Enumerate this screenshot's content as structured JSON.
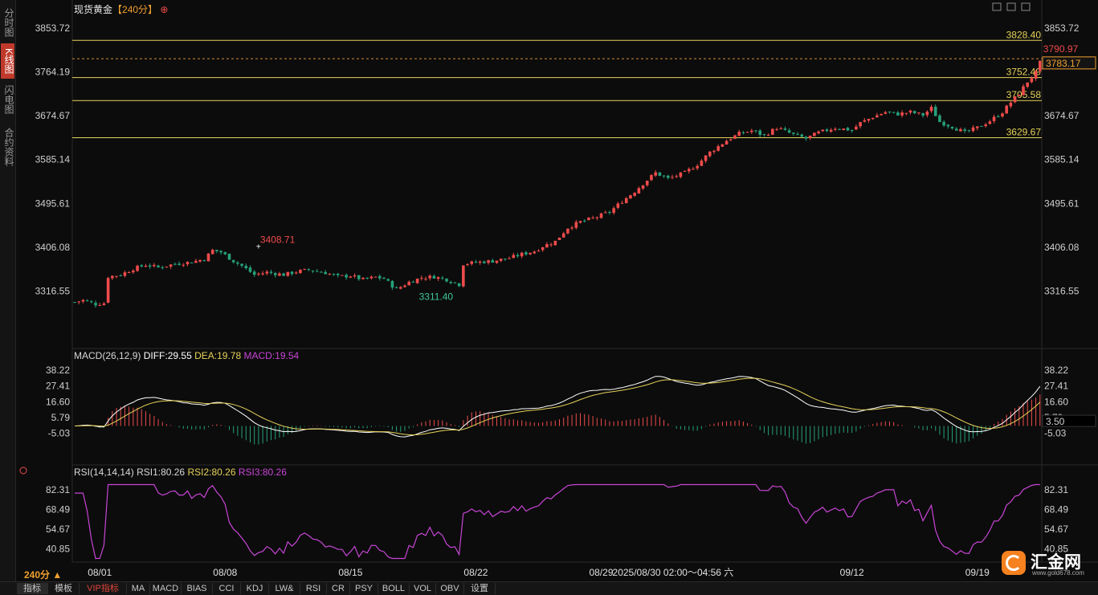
{
  "sidebar": {
    "tabs": [
      "分时图",
      "K线图",
      "闪电图",
      "合约资料"
    ],
    "active": 1
  },
  "header": {
    "title": "现货黄金",
    "period": "【240分】",
    "add_icon": "circle-plus-icon"
  },
  "macd_header": {
    "label": "MACD(26,12,9)",
    "diff": "DIFF:29.55",
    "dea": "DEA:19.78",
    "macd": "MACD:19.54"
  },
  "rsi_header": {
    "label": "RSI(14,14,14)",
    "rsi1": "RSI1:80.26",
    "rsi2": "RSI2:80.26",
    "rsi3": "RSI3:80.26"
  },
  "colors": {
    "up": "#ef4b4b",
    "down": "#26a07a",
    "line_yellow": "#e6d25a",
    "rsi": "#c845d6",
    "diff": "#ffffff",
    "dea": "#e6d25a",
    "label_red": "#ef4b4b",
    "label_green": "#3ec49a"
  },
  "chart_data": [
    {
      "type": "candlestick",
      "title": "现货黄金",
      "period": "240分",
      "y_ticks": [
        "3853.72",
        "3764.19",
        "3674.67",
        "3585.14",
        "3495.61",
        "3406.08",
        "3316.55"
      ],
      "right_ticks": [
        "3853.72",
        "3674.67",
        "3585.14",
        "3495.61",
        "3406.08",
        "3316.55"
      ],
      "ylim": [
        3283,
        3878
      ],
      "x_labels": [
        "08/01",
        "08/08",
        "08/15",
        "08/22",
        "08/29",
        "09/12",
        "09/19"
      ],
      "cursor_time_label": "2025/08/30 02:00～04:56 六",
      "current_price": "3783.17",
      "high_label": "3408.71",
      "low_label": "3311.40",
      "peak_label": "3790.97",
      "horizontal_levels": [
        {
          "value": 3828.4,
          "label": "3828.40"
        },
        {
          "value": 3752.49,
          "label": "3752.49"
        },
        {
          "value": 3705.58,
          "label": "3705.58"
        },
        {
          "value": 3629.67,
          "label": "3629.67"
        }
      ],
      "dashed_level": 3790.97,
      "close_path": [
        [
          0,
          3294
        ],
        [
          2,
          3298
        ],
        [
          5,
          3290
        ],
        [
          7,
          3292
        ],
        [
          8,
          3346
        ],
        [
          11,
          3350
        ],
        [
          14,
          3362
        ],
        [
          17,
          3370
        ],
        [
          20,
          3365
        ],
        [
          24,
          3372
        ],
        [
          28,
          3376
        ],
        [
          31,
          3382
        ],
        [
          33,
          3400
        ],
        [
          35,
          3396
        ],
        [
          38,
          3378
        ],
        [
          40,
          3368
        ],
        [
          43,
          3350
        ],
        [
          46,
          3355
        ],
        [
          50,
          3350
        ],
        [
          53,
          3356
        ],
        [
          56,
          3360
        ],
        [
          60,
          3354
        ],
        [
          63,
          3346
        ],
        [
          66,
          3348
        ],
        [
          69,
          3340
        ],
        [
          72,
          3345
        ],
        [
          74,
          3342
        ],
        [
          77,
          3320
        ],
        [
          80,
          3335
        ],
        [
          83,
          3344
        ],
        [
          86,
          3346
        ],
        [
          89,
          3340
        ],
        [
          92,
          3330
        ],
        [
          93,
          3372
        ],
        [
          97,
          3376
        ],
        [
          100,
          3378
        ],
        [
          104,
          3384
        ],
        [
          107,
          3392
        ],
        [
          110,
          3398
        ],
        [
          112,
          3408
        ],
        [
          115,
          3418
        ],
        [
          118,
          3446
        ],
        [
          121,
          3458
        ],
        [
          124,
          3465
        ],
        [
          128,
          3478
        ],
        [
          131,
          3500
        ],
        [
          134,
          3520
        ],
        [
          136,
          3536
        ],
        [
          139,
          3558
        ],
        [
          142,
          3546
        ],
        [
          146,
          3558
        ],
        [
          149,
          3575
        ],
        [
          152,
          3600
        ],
        [
          156,
          3624
        ],
        [
          159,
          3638
        ],
        [
          162,
          3644
        ],
        [
          165,
          3634
        ],
        [
          168,
          3650
        ],
        [
          172,
          3636
        ],
        [
          175,
          3628
        ],
        [
          178,
          3640
        ],
        [
          182,
          3650
        ],
        [
          186,
          3645
        ],
        [
          188,
          3660
        ],
        [
          191,
          3672
        ],
        [
          194,
          3682
        ],
        [
          197,
          3678
        ],
        [
          200,
          3682
        ],
        [
          203,
          3676
        ],
        [
          205,
          3690
        ],
        [
          207,
          3662
        ],
        [
          210,
          3652
        ],
        [
          213,
          3640
        ],
        [
          216,
          3650
        ],
        [
          219,
          3664
        ],
        [
          222,
          3682
        ],
        [
          224,
          3702
        ],
        [
          226,
          3720
        ],
        [
          228,
          3744
        ],
        [
          230,
          3762
        ],
        [
          231,
          3783
        ]
      ],
      "macd": {
        "ylim": [
          -25,
          42
        ],
        "ticks": [
          "38.22",
          "27.41",
          "16.60",
          "5.79",
          "-5.03"
        ],
        "current": "3.50"
      },
      "rsi": {
        "ylim": [
          32,
          88
        ],
        "ticks": [
          "82.31",
          "68.49",
          "54.67",
          "40.85"
        ]
      }
    }
  ],
  "bottom_tabs": [
    "指标",
    "模板",
    "VIP指标",
    "MA",
    "MACD",
    "BIAS",
    "CCI",
    "KDJ",
    "LW&",
    "RSI",
    "CR",
    "PSY",
    "BOLL",
    "VOL",
    "OBV",
    "设置"
  ],
  "period_selector": "240分 ▲",
  "brand": {
    "name": "汇金网",
    "url": "www.gold678.com"
  }
}
